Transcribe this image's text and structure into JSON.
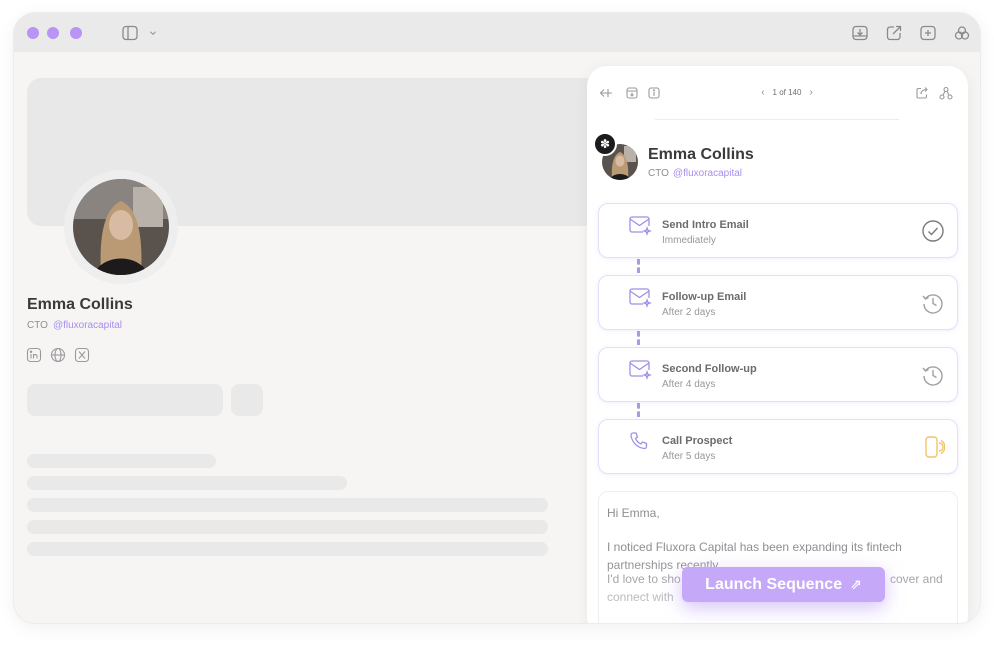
{
  "window": {
    "accent": "#b994f5",
    "toolbar_icons": [
      "sidebar-toggle-icon",
      "chevron-down-icon",
      "download-icon",
      "external-link-icon",
      "new-tab-icon",
      "extensions-icon"
    ]
  },
  "left_profile": {
    "name": "Emma Collins",
    "role": "CTO",
    "handle": "@fluxoracapital",
    "socials": [
      "linkedin-icon",
      "globe-icon",
      "x-icon"
    ]
  },
  "panel": {
    "pager": {
      "current": "1",
      "total": "140",
      "label": "1 of 140",
      "prev": "‹",
      "next": "›"
    },
    "contact": {
      "name": "Emma Collins",
      "role": "CTO",
      "handle": "@fluxoracapital",
      "badge": "✽"
    },
    "steps": [
      {
        "title": "Send Intro Email",
        "timing": "Immediately",
        "icon": "mail-sparkle-icon",
        "status": "completed"
      },
      {
        "title": "Follow-up Email",
        "timing": "After 2 days",
        "icon": "mail-sparkle-icon",
        "status": "scheduled"
      },
      {
        "title": "Second Follow-up",
        "timing": "After 4 days",
        "icon": "mail-sparkle-icon",
        "status": "scheduled"
      },
      {
        "title": "Call Prospect",
        "timing": "After 5 days",
        "icon": "phone-icon",
        "status": "pending-call"
      }
    ],
    "email": {
      "greeting": "Hi Emma,",
      "para1": "I noticed Fluxora Capital has been expanding its fintech partnerships recently.",
      "para2_start": "I'd love to sho",
      "para2_end": "cover and",
      "para3_start": "connect with"
    }
  },
  "launch": {
    "label": "Launch Sequence",
    "arrow": "⇗"
  }
}
